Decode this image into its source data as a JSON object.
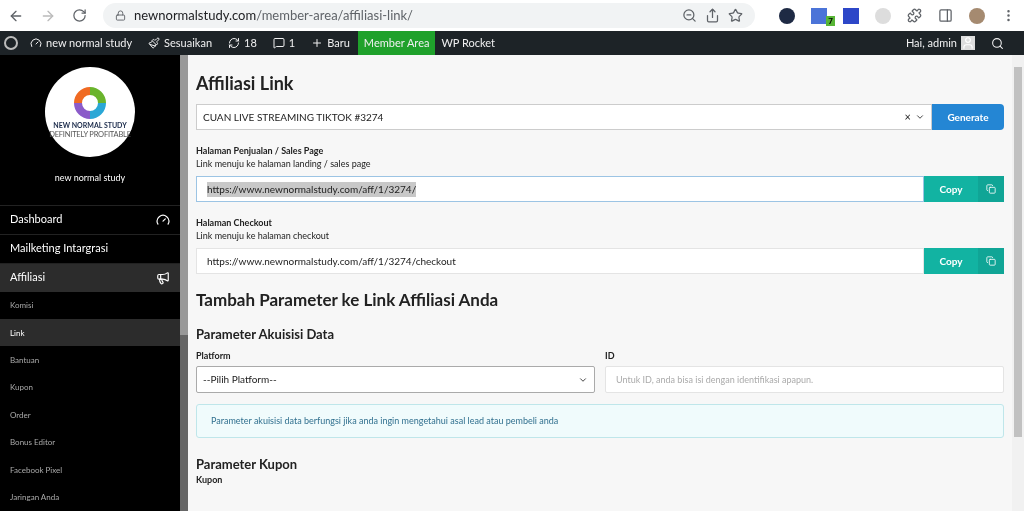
{
  "browser": {
    "url_host": "newnormalstudy.com",
    "url_path": "/member-area/affiliasi-link/",
    "extension_badge": "7"
  },
  "admin_bar": {
    "site": "new normal study",
    "customize": "Sesuaikan",
    "updates": "18",
    "comments": "1",
    "new": "Baru",
    "items": [
      {
        "label": "Member Area",
        "selected": true
      },
      {
        "label": "WP Rocket",
        "selected": false
      }
    ],
    "greeting": "Hai, admin"
  },
  "sidebar": {
    "logo_title": "NEW NORMAL STUDY",
    "logo_subtitle": "DEFINITELY PROFITABLE",
    "site_name": "new normal study",
    "menu": [
      {
        "label": "Dashboard",
        "selected": false
      },
      {
        "label": "Mailketing Intargrasi",
        "selected": false
      },
      {
        "label": "Affiliasi",
        "selected": true
      }
    ],
    "submenu": [
      {
        "label": "Komisi",
        "selected": false
      },
      {
        "label": "Link",
        "selected": true
      },
      {
        "label": "Bantuan",
        "selected": false
      },
      {
        "label": "Kupon",
        "selected": false
      },
      {
        "label": "Order",
        "selected": false
      },
      {
        "label": "Bonus Editor",
        "selected": false
      },
      {
        "label": "Facebook Pixel",
        "selected": false
      },
      {
        "label": "Jaringan Anda",
        "selected": false
      }
    ]
  },
  "main": {
    "title": "Affiliasi Link",
    "product_select": "CUAN LIVE STREAMING TIKTOK #3274",
    "clear": "×",
    "generate": "Generate",
    "links": [
      {
        "label": "Halaman Penjualan / Sales Page",
        "description": "Link menuju ke halaman landing / sales page",
        "value": "https://www.newnormalstudy.com/aff/1/3274/",
        "selected": true,
        "copy": "Copy"
      },
      {
        "label": "Halaman Checkout",
        "description": "Link menuju ke halaman checkout",
        "value": "https://www.newnormalstudy.com/aff/1/3274/checkout",
        "selected": false,
        "copy": "Copy"
      }
    ],
    "params_title": "Tambah Parameter ke Link Affiliasi Anda",
    "acq_title": "Parameter Akuisisi Data",
    "platform_label": "Platform",
    "platform_value": "--Pilih Platform--",
    "id_label": "ID",
    "id_placeholder": "Untuk ID, anda bisa isi dengan identifikasi apapun.",
    "alert": "Parameter akuisisi data berfungsi jika anda ingin mengetahui asal lead atau pembeli anda",
    "coupon_title": "Parameter Kupon",
    "coupon_label": "Kupon"
  }
}
